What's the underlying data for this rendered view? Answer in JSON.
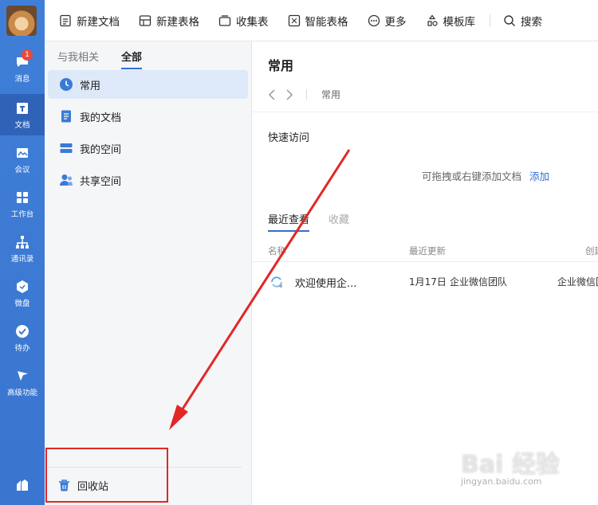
{
  "nav": {
    "badge_count": "1",
    "items": [
      {
        "label": "消息",
        "icon": "chat-bubble-icon"
      },
      {
        "label": "文档",
        "icon": "document-icon"
      },
      {
        "label": "会议",
        "icon": "meeting-icon"
      },
      {
        "label": "工作台",
        "icon": "grid-icon"
      },
      {
        "label": "通讯录",
        "icon": "org-chart-icon"
      },
      {
        "label": "微盘",
        "icon": "cloud-drive-icon"
      },
      {
        "label": "待办",
        "icon": "check-circle-icon"
      },
      {
        "label": "高级功能",
        "icon": "sparkle-icon"
      }
    ]
  },
  "toolbar": {
    "new_doc": "新建文档",
    "new_sheet": "新建表格",
    "collect": "收集表",
    "smart_sheet": "智能表格",
    "more": "更多",
    "templates": "模板库",
    "search": "搜索"
  },
  "sidebar": {
    "tabs": [
      "与我相关",
      "全部"
    ],
    "items": [
      "常用",
      "我的文档",
      "我的空间",
      "共享空间"
    ],
    "trash": "回收站"
  },
  "main": {
    "title": "常用",
    "breadcrumb": "常用",
    "quick_access_title": "快速访问",
    "quick_access_hint": "可拖拽或右键添加文档",
    "quick_access_add": "添加",
    "recent_tabs": [
      "最近查看",
      "收藏"
    ],
    "columns": [
      "名称",
      "最近更新",
      "创建"
    ],
    "rows": [
      {
        "name": "欢迎使用企...",
        "updated_date": "1月17日",
        "updated_by": "企业微信团队",
        "creator": "企业微信团队"
      }
    ]
  },
  "watermark": {
    "text": "Bai 经验",
    "sub": "jingyan.baidu.com"
  },
  "colors": {
    "nav_bg": "#3a7bd5",
    "accent": "#2f6fd6",
    "annotation": "#e32626"
  }
}
